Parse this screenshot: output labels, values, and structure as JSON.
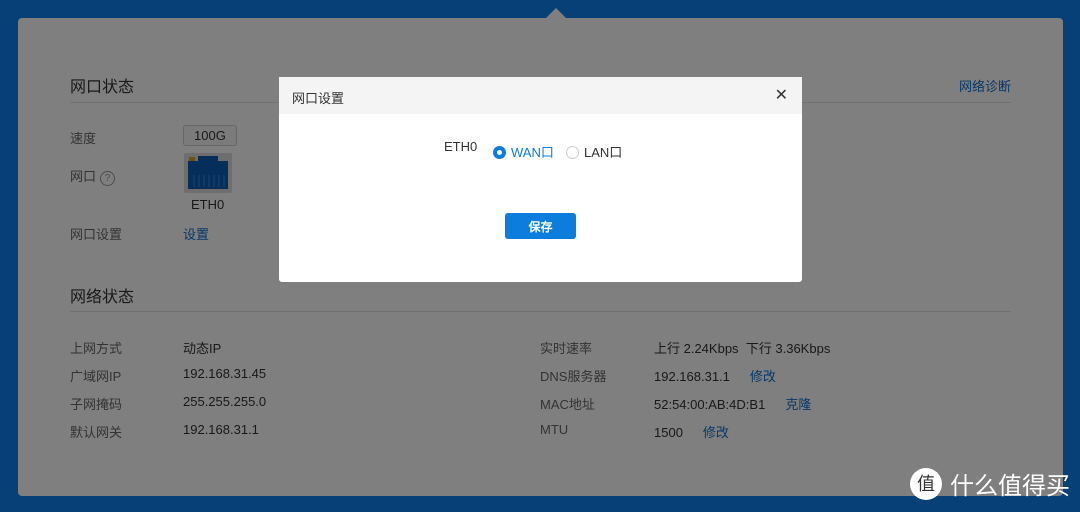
{
  "port_status": {
    "title": "网口状态",
    "diagnose": "网络诊断",
    "speed_label": "速度",
    "speed": "100G",
    "port_label": "网口",
    "help": "?",
    "port_name": "ETH0",
    "port_setting_label": "网口设置",
    "port_setting_link": "设置"
  },
  "network_status": {
    "title": "网络状态",
    "left": [
      {
        "label": "上网方式",
        "value": "动态IP"
      },
      {
        "label": "广域网IP",
        "value": "192.168.31.45"
      },
      {
        "label": "子网掩码",
        "value": "255.255.255.0"
      },
      {
        "label": "默认网关",
        "value": "192.168.31.1"
      }
    ],
    "right": [
      {
        "label": "实时速率",
        "value": "上行 2.24Kbps  下行 3.36Kbps",
        "link": ""
      },
      {
        "label": "DNS服务器",
        "value": "192.168.31.1",
        "link": "修改"
      },
      {
        "label": "MAC地址",
        "value": "52:54:00:AB:4D:B1",
        "link": "克隆"
      },
      {
        "label": "MTU",
        "value": "1500",
        "link": "修改"
      }
    ]
  },
  "modal": {
    "title": "网口设置",
    "close": "✕",
    "port": "ETH0",
    "options": [
      {
        "label": "WAN口",
        "selected": true
      },
      {
        "label": "LAN口",
        "selected": false
      }
    ],
    "save": "保存"
  },
  "watermark": {
    "icon": "值",
    "text": "什么值得买"
  }
}
